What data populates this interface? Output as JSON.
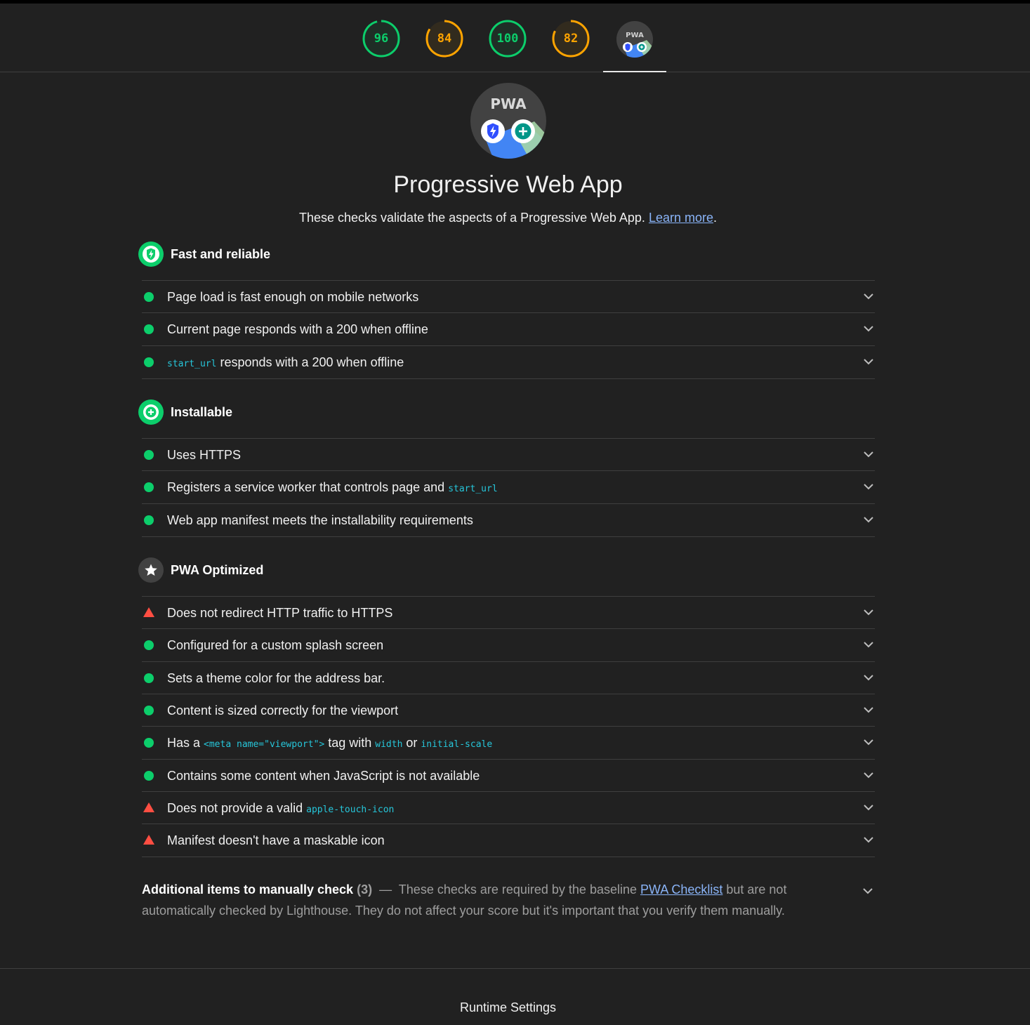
{
  "gauges": [
    {
      "score": "96",
      "value": 96,
      "status": "pass",
      "color": "#0cce6b"
    },
    {
      "score": "84",
      "value": 84,
      "status": "average",
      "color": "#ffa400"
    },
    {
      "score": "100",
      "value": 100,
      "status": "pass",
      "color": "#0cce6b"
    },
    {
      "score": "82",
      "value": 82,
      "status": "average",
      "color": "#ffa400"
    }
  ],
  "pwa_badge_text": "PWA",
  "category": {
    "title": "Progressive Web App",
    "description": "These checks validate the aspects of a Progressive Web App.",
    "learn_more": "Learn more",
    "period": "."
  },
  "groups": [
    {
      "title": "Fast and reliable",
      "icon": "lightning-shield-icon",
      "audits": [
        {
          "status": "pass",
          "text": "Page load is fast enough on mobile networks"
        },
        {
          "status": "pass",
          "text": "Current page responds with a 200 when offline"
        },
        {
          "status": "pass",
          "code": "start_url",
          "text_after": " responds with a 200 when offline"
        }
      ]
    },
    {
      "title": "Installable",
      "icon": "plus-circle-icon",
      "audits": [
        {
          "status": "pass",
          "text": "Uses HTTPS"
        },
        {
          "status": "pass",
          "text": "Registers a service worker that controls page and ",
          "code": "start_url"
        },
        {
          "status": "pass",
          "text": "Web app manifest meets the installability requirements"
        }
      ]
    },
    {
      "title": "PWA Optimized",
      "icon": "star-icon",
      "audits": [
        {
          "status": "fail",
          "text": "Does not redirect HTTP traffic to HTTPS"
        },
        {
          "status": "pass",
          "text": "Configured for a custom splash screen"
        },
        {
          "status": "pass",
          "text": "Sets a theme color for the address bar."
        },
        {
          "status": "pass",
          "text": "Content is sized correctly for the viewport"
        },
        {
          "status": "pass",
          "text": "Has a ",
          "code": "<meta name=\"viewport\">",
          "text2": " tag with ",
          "code2": "width",
          "text3": " or ",
          "code3": "initial-scale"
        },
        {
          "status": "pass",
          "text": "Contains some content when JavaScript is not available"
        },
        {
          "status": "fail",
          "text": "Does not provide a valid ",
          "code": "apple-touch-icon"
        },
        {
          "status": "fail",
          "text": "Manifest doesn't have a maskable icon"
        }
      ]
    }
  ],
  "manual": {
    "title": "Additional items to manually check",
    "count": "(3)",
    "dash": "—",
    "text_before": "These checks are required by the baseline ",
    "link": "PWA Checklist",
    "text_after": " but are not automatically checked by Lighthouse. They do not affect your score but it's important that you verify them manually."
  },
  "runtime_settings": "Runtime Settings",
  "colors": {
    "background": "#212121",
    "pass": "#0cce6b",
    "average": "#ffa400",
    "fail": "#ff4e42",
    "code": "#26c6da",
    "link": "#8ab4f8"
  }
}
